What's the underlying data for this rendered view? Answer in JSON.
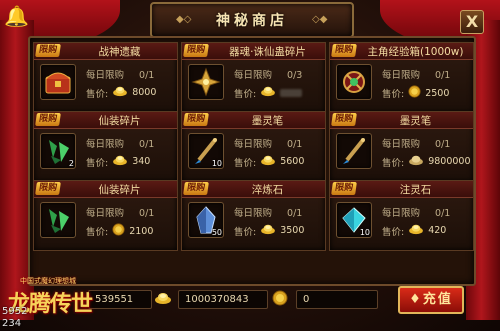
{
  "window": {
    "title": "神秘商店",
    "close_label": "X"
  },
  "badge_text": "限购",
  "limit_label": "每日限购",
  "price_label": "售价:",
  "items": [
    {
      "name": "战神遗藏",
      "limit": "0/1",
      "price": "8000",
      "currency": "gold",
      "qty": "",
      "icon": "treasure-chest-icon"
    },
    {
      "name": "器魂·诛仙蛊碎片",
      "limit": "0/3",
      "price": "",
      "currency": "gold",
      "qty": "",
      "icon": "golden-fragment-icon"
    },
    {
      "name": "主角经验箱(1000w)",
      "limit": "0/1",
      "price": "2500",
      "currency": "coin",
      "qty": "",
      "icon": "experience-box-icon"
    },
    {
      "name": "仙装碎片",
      "limit": "0/1",
      "price": "340",
      "currency": "gold",
      "qty": "2",
      "icon": "green-shard-icon"
    },
    {
      "name": "墨灵笔",
      "limit": "0/1",
      "price": "5600",
      "currency": "gold",
      "qty": "10",
      "icon": "ink-brush-icon"
    },
    {
      "name": "墨灵笔",
      "limit": "0/1",
      "price": "9800000",
      "currency": "silver",
      "qty": "",
      "icon": "ink-brush-icon"
    },
    {
      "name": "仙装碎片",
      "limit": "0/1",
      "price": "2100",
      "currency": "coin",
      "qty": "",
      "icon": "green-shard-icon"
    },
    {
      "name": "淬炼石",
      "limit": "0/1",
      "price": "3500",
      "currency": "gold",
      "qty": "50",
      "icon": "blue-crystal-icon"
    },
    {
      "name": "注灵石",
      "limit": "0/1",
      "price": "420",
      "currency": "gold",
      "qty": "10",
      "icon": "cyan-gem-icon"
    }
  ],
  "bottom": {
    "field1": "539551",
    "field2": "1000370843",
    "field3": "0",
    "recharge_label": "充值"
  },
  "logo": {
    "main_text": "龙腾传世",
    "sub_text": "中国式魔幻理想城"
  },
  "corner_numbers": [
    "5952",
    "234"
  ],
  "colors": {
    "gold_text": "#f3dca2",
    "badge": "#ffcf4a",
    "recharge": "#d92b18"
  }
}
